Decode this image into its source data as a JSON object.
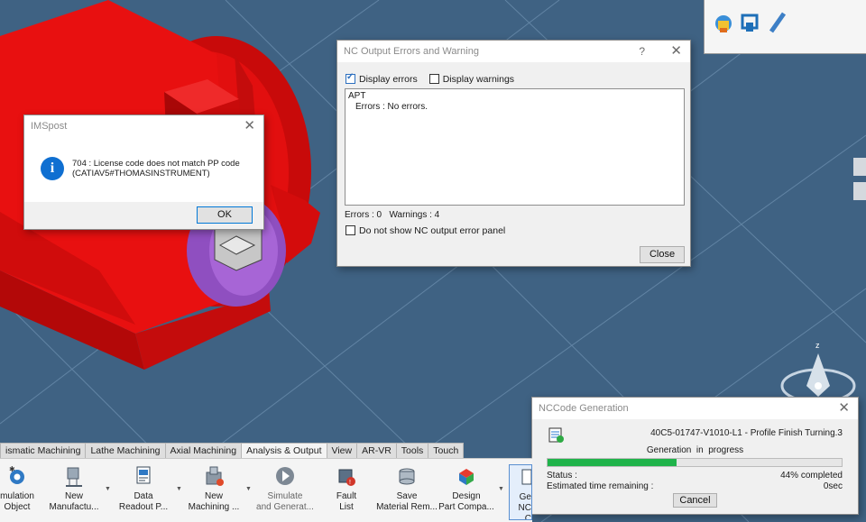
{
  "imspost": {
    "title": "IMSpost",
    "message_line1": "704 : License code does not match PP code",
    "message_line2": "(CATIAV5#THOMASINSTRUMENT)",
    "ok_label": "OK"
  },
  "nc_output": {
    "title": "NC Output Errors and Warning",
    "help": "?",
    "display_errors_label": "Display errors",
    "display_errors_checked": true,
    "display_warnings_label": "Display warnings",
    "display_warnings_checked": false,
    "log_line1": "APT",
    "log_line2": "Errors :  No errors.",
    "summary": "Errors : 0   Warnings : 4",
    "do_not_show_label": "Do not show NC output error panel",
    "close_label": "Close"
  },
  "nccode": {
    "title": "NCCode Generation",
    "operation": "40C5-01747-V1010-L1 - Profile Finish Turning.3",
    "status_heading": "Generation  in  progress",
    "progress": 0.44,
    "status_label": "Status :",
    "status_value": "44% completed",
    "time_label": "Estimated time remaining :",
    "time_value": "0sec",
    "cancel_label": "Cancel"
  },
  "ribbon": {
    "tabs": [
      "ismatic Machining",
      "Lathe Machining",
      "Axial Machining",
      "Analysis & Output",
      "View",
      "AR-VR",
      "Tools",
      "Touch"
    ],
    "active_tab": "Analysis & Output",
    "buttons": [
      {
        "line1": "mulation",
        "line2": "Object"
      },
      {
        "line1": "New",
        "line2": "Manufactu..."
      },
      {
        "line1": "Data",
        "line2": "Readout P..."
      },
      {
        "line1": "New",
        "line2": "Machining ..."
      },
      {
        "line1": "Simulate",
        "line2": "and Generat..."
      },
      {
        "line1": "Fault",
        "line2": "List"
      },
      {
        "line1": "Save",
        "line2": "Material Rem..."
      },
      {
        "line1": "Design",
        "line2": "Part Compa..."
      },
      {
        "line1": "Ge",
        "line2": "NC C"
      }
    ]
  },
  "compass": {
    "axis_label": "z"
  },
  "colors": {
    "background": "#3f6283",
    "part_red": "#e00d0d",
    "accent_purple": "#9b55c9",
    "progress_green": "#1fb34a",
    "info_blue": "#0f6fd1"
  }
}
